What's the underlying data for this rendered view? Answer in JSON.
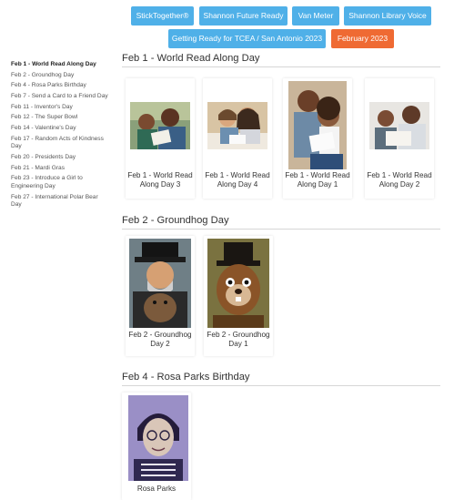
{
  "nav": {
    "buttons": [
      {
        "label": "StickTogether®"
      },
      {
        "label": "Shannon Future Ready"
      },
      {
        "label": "Van Meter"
      },
      {
        "label": "Shannon Library Voice"
      },
      {
        "label": "Getting Ready for TCEA / San Antonio 2023"
      },
      {
        "label": "February 2023"
      }
    ],
    "active_color": "#ef6a33",
    "button_color": "#4fb0e8"
  },
  "sidebar": {
    "items": [
      {
        "label": "Feb 1 - World Read Along Day"
      },
      {
        "label": "Feb 2 - Groundhog Day"
      },
      {
        "label": "Feb 4 - Rosa Parks Birthday"
      },
      {
        "label": "Feb 7 - Send a Card to a Friend Day"
      },
      {
        "label": "Feb 11 - Inventor's Day"
      },
      {
        "label": "Feb 12 - The Super Bowl"
      },
      {
        "label": "Feb 14 - Valentine's Day"
      },
      {
        "label": "Feb 17 - Random Acts of Kindness Day"
      },
      {
        "label": "Feb 20 - Presidents Day"
      },
      {
        "label": "Feb 21 - Mardi Gras"
      },
      {
        "label": "Feb 23 - Introduce a Girl to Engineering Day"
      },
      {
        "label": "Feb 27 - International Polar Bear Day"
      }
    ]
  },
  "sections": [
    {
      "title": "Feb 1 - World Read Along Day",
      "cards": [
        {
          "caption": "Feb 1 - World Read Along Day 3",
          "icon": "father-child-reading-image"
        },
        {
          "caption": "Feb 1 - World Read Along Day 4",
          "icon": "mother-child-reading-image"
        },
        {
          "caption": "Feb 1 - World Read Along Day 1",
          "icon": "father-daughter-reading-image"
        },
        {
          "caption": "Feb 1 - World Read Along Day 2",
          "icon": "father-son-reading-image"
        }
      ]
    },
    {
      "title": "Feb 2 - Groundhog Day",
      "cards": [
        {
          "caption": "Feb 2 - Groundhog Day 2",
          "icon": "man-holding-groundhog-image"
        },
        {
          "caption": "Feb 2 - Groundhog Day 1",
          "icon": "groundhog-top-hat-image"
        }
      ]
    },
    {
      "title": "Feb 4 - Rosa Parks Birthday",
      "cards": [
        {
          "caption": "Rosa Parks",
          "icon": "rosa-parks-portrait-image"
        }
      ]
    }
  ]
}
